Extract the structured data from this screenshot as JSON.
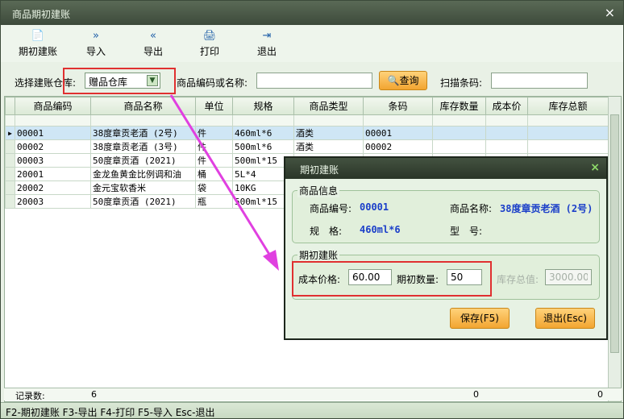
{
  "window": {
    "title": "商品期初建账",
    "close_glyph": "×"
  },
  "toolbar": [
    {
      "label": "期初建账",
      "icon": "document-icon",
      "glyph": "📄"
    },
    {
      "label": "导入",
      "icon": "import-icon",
      "glyph": "»"
    },
    {
      "label": "导出",
      "icon": "export-icon",
      "glyph": "«"
    },
    {
      "label": "打印",
      "icon": "printer-icon",
      "glyph": "🖨"
    },
    {
      "label": "退出",
      "icon": "exit-icon",
      "glyph": "⇥"
    }
  ],
  "filter": {
    "warehouse_label": "选择建账仓库:",
    "warehouse_value": "赠品仓库",
    "code_label": "商品编码或名称:",
    "code_value": "",
    "query_label": "查询",
    "scan_label": "扫描条码:",
    "scan_value": ""
  },
  "table": {
    "columns": [
      "商品编码",
      "商品名称",
      "单位",
      "规格",
      "商品类型",
      "条码",
      "库存数量",
      "成本价",
      "库存总额"
    ],
    "rows": [
      [
        "00001",
        "38度章贡老酒 (2号)",
        "件",
        "460ml*6",
        "酒类",
        "00001",
        "",
        "",
        ""
      ],
      [
        "00002",
        "38度章贡老酒 (3号)",
        "件",
        "500ml*6",
        "酒类",
        "00002",
        "",
        "",
        ""
      ],
      [
        "00003",
        "50度章贡酒 (2021)",
        "件",
        "500ml*15",
        "",
        "",
        "",
        "",
        ""
      ],
      [
        "20001",
        "金龙鱼黄金比例调和油",
        "桶",
        "5L*4",
        "",
        "",
        "",
        "",
        ""
      ],
      [
        "20002",
        "金元宝软香米",
        "袋",
        "10KG",
        "",
        "",
        "",
        "",
        ""
      ],
      [
        "20003",
        "50度章贡酒 (2021)",
        "瓶",
        "500ml*15",
        "",
        "",
        "",
        "",
        ""
      ]
    ]
  },
  "footer": {
    "record_label": "记录数:",
    "record_count": "6",
    "qty_total": "0",
    "amount_total": "0"
  },
  "status": {
    "text": "F2-期初建账 F3-导出 F4-打印 F5-导入 Esc-退出"
  },
  "dialog": {
    "title": "期初建账",
    "info_group": "商品信息",
    "code_label": "商品编号:",
    "code_value": "00001",
    "name_label": "商品名称:",
    "name_value": "38度章贡老酒 (2号)",
    "spec_label": "规　格:",
    "spec_value": "460ml*6",
    "model_label": "型　号:",
    "model_value": "",
    "entry_group": "期初建账",
    "cost_label": "成本价格:",
    "cost_value": "60.00",
    "qty_label": "期初数量:",
    "qty_value": "50",
    "total_label": "库存总值:",
    "total_value": "3000.00",
    "save_label": "保存(F5)",
    "exit_label": "退出(Esc)"
  },
  "colors": {
    "highlight": "#e03030",
    "arrow": "#e040e0",
    "button": "#f2a531",
    "value_blue": "#1a3ec9"
  }
}
